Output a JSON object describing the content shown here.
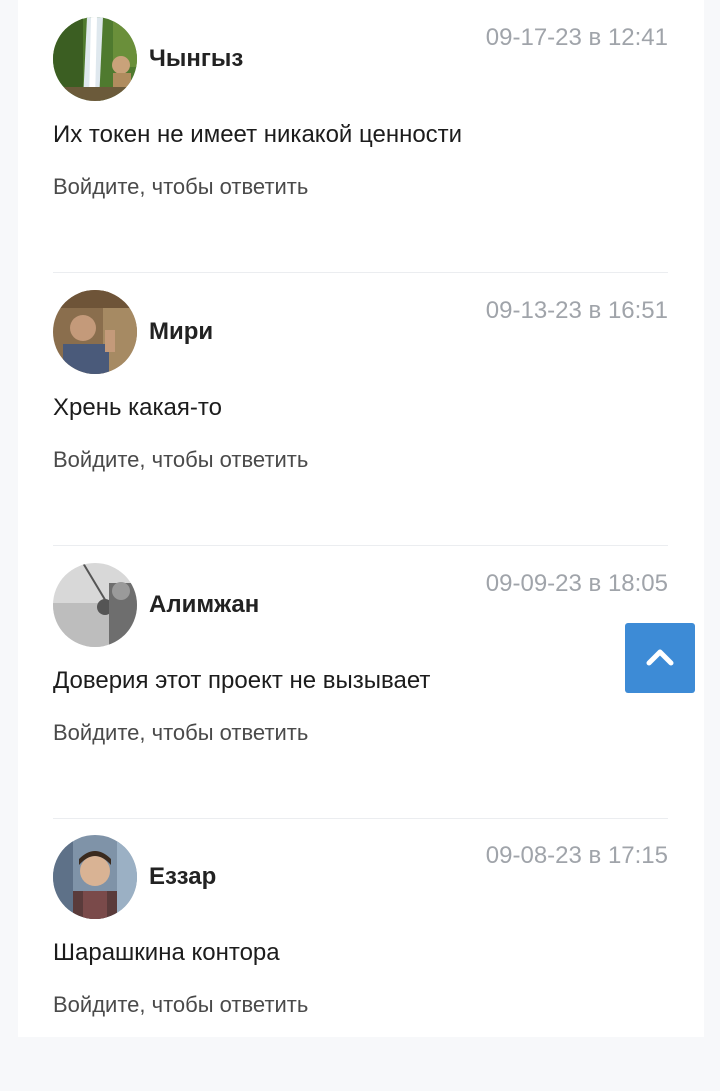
{
  "comments": [
    {
      "author": "Чынгыз",
      "date": "09-17-23 в 12:41",
      "text": "Их токен не имеет никакой ценности",
      "reply_label": "Войдите, чтобы ответить",
      "avatar": "waterfall-photo"
    },
    {
      "author": "Мири",
      "date": "09-13-23 в 16:51",
      "text": "Хрень какая-то",
      "reply_label": "Войдите, чтобы ответить",
      "avatar": "man-photo"
    },
    {
      "author": "Алимжан",
      "date": "09-09-23 в 18:05",
      "text": "Доверия этот проект не вызывает",
      "reply_label": "Войдите, чтобы ответить",
      "avatar": "bw-photo"
    },
    {
      "author": "Еззар",
      "date": "09-08-23 в 17:15",
      "text": "Шарашкина контора",
      "reply_label": "Войдите, чтобы ответить",
      "avatar": "portrait-photo"
    }
  ],
  "scroll_top": {
    "icon": "chevron-up-icon",
    "color": "#3d8bd6"
  }
}
